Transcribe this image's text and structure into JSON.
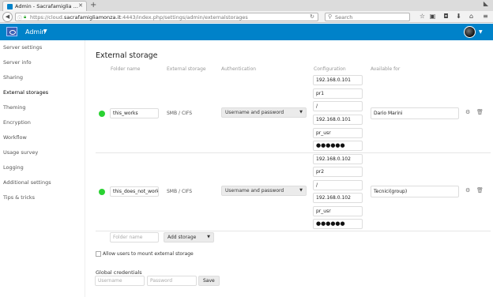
{
  "browser": {
    "tab_title": "Admin - Sacrafamiglia ...",
    "tab_close": "✕",
    "new_tab": "+",
    "url_prefix": "https://cloud.",
    "url_domain": "sacrafamigliamonza.it",
    "url_suffix": ":4443/index.php/settings/admin/externalstorages",
    "search_placeholder": "Search"
  },
  "header": {
    "app_name": "Admin",
    "brand_color": "#0082c9"
  },
  "sidebar": {
    "items": [
      {
        "label": "Server settings"
      },
      {
        "label": "Server info"
      },
      {
        "label": "Sharing"
      },
      {
        "label": "External storages"
      },
      {
        "label": "Theming"
      },
      {
        "label": "Encryption"
      },
      {
        "label": "Workflow"
      },
      {
        "label": "Usage survey"
      },
      {
        "label": "Logging"
      },
      {
        "label": "Additional settings"
      },
      {
        "label": "Tips & tricks"
      }
    ],
    "active": "External storages"
  },
  "main": {
    "title": "External storage",
    "columns": {
      "folder_name": "Folder name",
      "external_storage": "External storage",
      "authentication": "Authentication",
      "configuration": "Configuration",
      "available_for": "Available for"
    },
    "mounts": [
      {
        "status_color": "#2ad232",
        "folder_name": "this_works",
        "storage_type": "SMB / CIFS",
        "auth": "Username and password",
        "config": [
          "192.168.0.101",
          "pr1",
          "/",
          "192.168.0.101",
          "pr_usr",
          "●●●●●●"
        ],
        "available_for": "Dario Marini"
      },
      {
        "status_color": "#2ad232",
        "folder_name": "this_does_not_work",
        "storage_type": "SMB / CIFS",
        "auth": "Username and password",
        "config": [
          "192.168.0.102",
          "pr2",
          "/",
          "192.168.0.102",
          "pr_usr",
          "●●●●●●"
        ],
        "available_for": "Tecnici(group)"
      }
    ],
    "new_folder_placeholder": "Folder name",
    "add_storage_label": "Add storage",
    "allow_users_label": "Allow users to mount external storage",
    "global_credentials_title": "Global credentials",
    "username_placeholder": "Username",
    "password_placeholder": "Password",
    "save_label": "Save"
  }
}
